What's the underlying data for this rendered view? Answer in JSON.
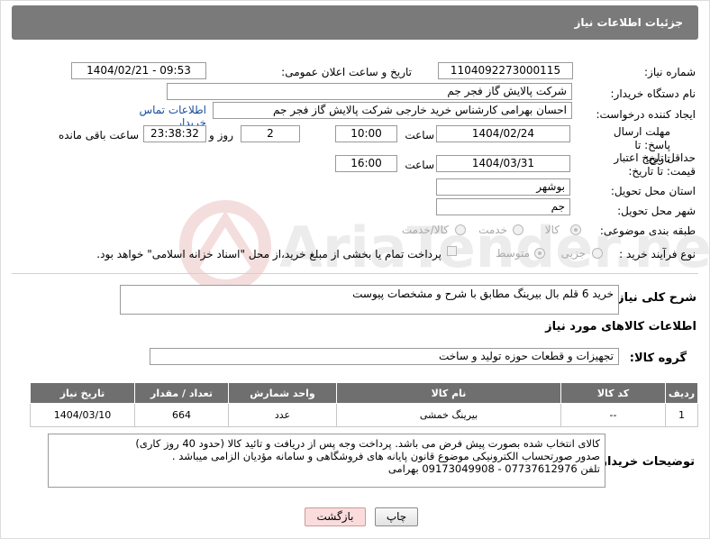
{
  "header": {
    "title": "جزئیات اطلاعات نیاز"
  },
  "labels": {
    "need_number": "شماره نیاز:",
    "announce_datetime": "تاریخ و ساعت اعلان عمومی:",
    "buyer_org": "نام دستگاه خریدار:",
    "requester": "ایجاد کننده درخواست:",
    "buyer_contact_link": "اطلاعات تماس خریدار",
    "reply_deadline": "مهلت ارسال پاسخ: تا تاریخ:",
    "time": "ساعت",
    "days_and": "روز و",
    "hours_left": "ساعت باقی مانده",
    "price_validity": "حداقل تاریخ اعتبار قیمت: تا تاریخ:",
    "province": "استان محل تحویل:",
    "city": "شهر محل تحویل:",
    "category": "طبقه بندی موضوعی:",
    "purchase_type": "نوع فرآیند خرید :",
    "need_summary": "شرح کلی نیاز:",
    "goods_info": "اطلاعات کالاهای مورد نیاز",
    "goods_group": "گروه کالا:",
    "buyer_notes": "توضیحات خریدار:"
  },
  "values": {
    "need_number": "1104092273000115",
    "announce_datetime": "1404/02/21 - 09:53",
    "buyer_org": "شرکت پالایش گاز فجر جم",
    "requester": "احسان بهرامی کارشناس خرید خارجی شرکت پالایش گاز فجر جم",
    "reply_date": "1404/02/24",
    "reply_time": "10:00",
    "days": "2",
    "remaining": "23:38:32",
    "validity_date": "1404/03/31",
    "validity_time": "16:00",
    "province": "بوشهر",
    "city": "جم",
    "need_summary": "خرید 6 قلم بال بیرینگ مطابق با شرح و مشخصات پیوست",
    "goods_group": "تجهیزات و قطعات حوزه تولید و ساخت",
    "buyer_notes": "کالای انتخاب شده بصورت پیش فرض می باشد. پرداخت وجه پس از دریافت و تائید کالا (حدود 40 روز کاری)\nصدور صورتحساب الکترونیکی موضوع قانون پایانه های فروشگاهی و سامانه مؤدیان الزامی میباشد .\nتلفن 07737612976 - 09173049908 بهرامی"
  },
  "options": {
    "category": [
      "کالا",
      "خدمت",
      "کالا/خدمت"
    ],
    "category_selected": "کالا",
    "purchase": [
      "جزیی",
      "متوسط"
    ],
    "payment_note": "پرداخت تمام یا بخشی از مبلغ خرید،از محل \"اسناد خزانه اسلامی\" خواهد بود."
  },
  "table": {
    "headers": [
      "ردیف",
      "کد کالا",
      "نام کالا",
      "واحد شمارش",
      "تعداد / مقدار",
      "تاریخ نیاز"
    ],
    "rows": [
      [
        "1",
        "--",
        "بیرینگ خمشی",
        "عدد",
        "664",
        "1404/03/10"
      ]
    ]
  },
  "buttons": {
    "print": "چاپ",
    "back": "بازگشت"
  },
  "watermark": "AriaTender.neT",
  "colors": {
    "header_bg": "#7a7a7a",
    "table_header_bg": "#6f6f6f",
    "link": "#1a4fa0",
    "back_button_bg": "#fadcdc"
  }
}
